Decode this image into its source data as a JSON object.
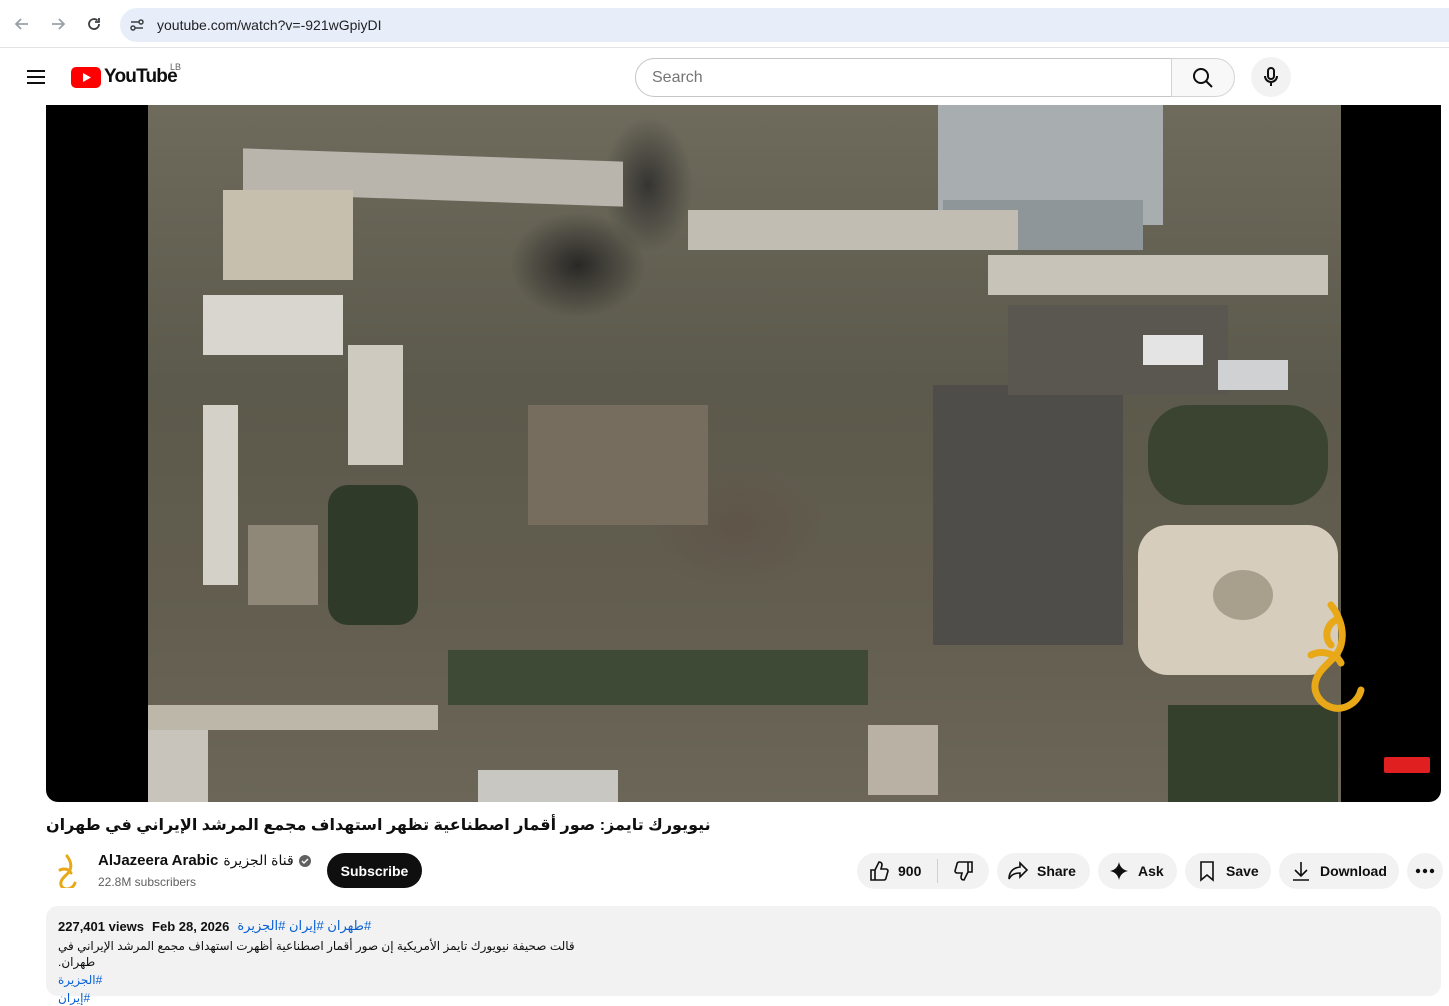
{
  "browser": {
    "url": "youtube.com/watch?v=-921wGpiyDI"
  },
  "header": {
    "logo_text": "YouTube",
    "region": "LB",
    "search_placeholder": "Search"
  },
  "video": {
    "title": "نيويورك تايمز: صور أقمار اصطناعية تظهر استهداف مجمع المرشد الإيراني في طهران"
  },
  "channel": {
    "name": "AlJazeera Arabic",
    "name_ar": "قناة الجزيرة",
    "subscribers": "22.8M subscribers",
    "subscribe_label": "Subscribe"
  },
  "actions": {
    "likes": "900",
    "share": "Share",
    "ask": "Ask",
    "save": "Save",
    "download": "Download"
  },
  "description": {
    "views": "227,401 views",
    "date": "Feb 28, 2026",
    "tags": "#طهران #إيران #الجزيرة",
    "text": "قالت صحيفة نيويورك تايمز الأمريكية إن صور أقمار اصطناعية أظهرت استهداف مجمع المرشد الإيراني في طهران.",
    "tag1": "#الجزيرة",
    "tag2": "#إيران"
  },
  "icons": [
    "back-icon",
    "forward-icon",
    "reload-icon",
    "site-info-icon",
    "hamburger-icon",
    "youtube-logo-icon",
    "search-icon",
    "mic-icon",
    "thumbs-up-icon",
    "thumbs-down-icon",
    "share-icon",
    "ask-sparkle-icon",
    "save-bookmark-icon",
    "download-icon",
    "more-icon",
    "verified-icon"
  ]
}
